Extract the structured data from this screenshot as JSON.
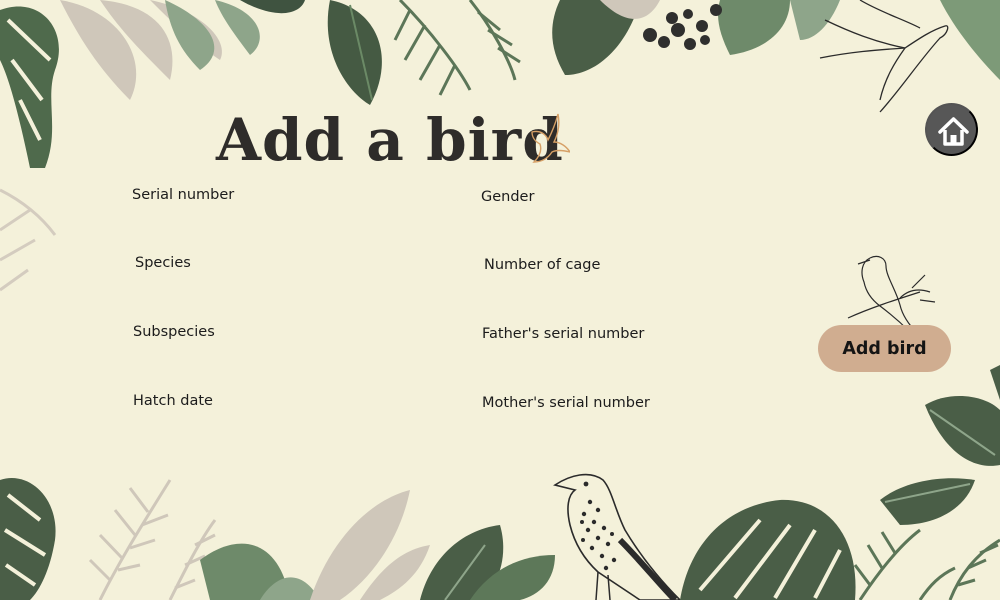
{
  "page": {
    "title": "Add a bird"
  },
  "form": {
    "left": [
      {
        "label": "Serial number"
      },
      {
        "label": "Species"
      },
      {
        "label": "Subspecies"
      },
      {
        "label": "Hatch date"
      }
    ],
    "right": [
      {
        "label": "Gender"
      },
      {
        "label": "Number of cage"
      },
      {
        "label": "Father's serial number"
      },
      {
        "label": "Mother's serial number"
      }
    ]
  },
  "actions": {
    "add_label": "Add bird",
    "home_icon": "home-icon"
  },
  "colors": {
    "background": "#f4f1da",
    "leaf_dark": "#4a5e47",
    "leaf_mid": "#6e8a6a",
    "leaf_pale": "#c7bfb2",
    "button": "#d0ad90",
    "home": "#575757"
  }
}
